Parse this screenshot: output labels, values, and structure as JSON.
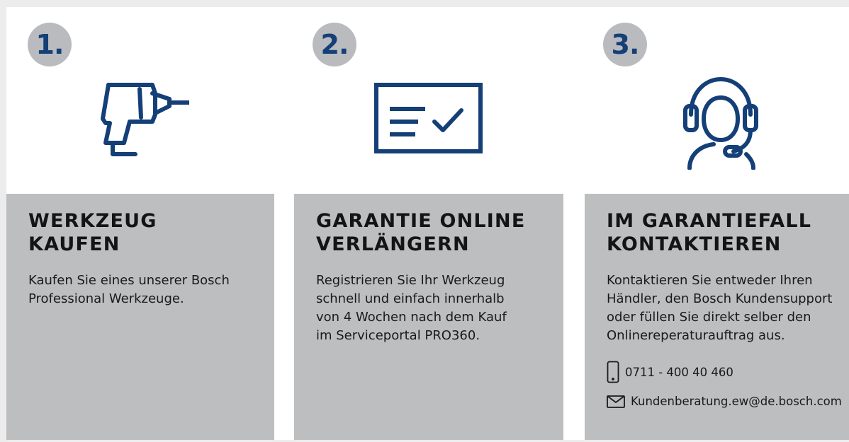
{
  "steps": [
    {
      "number": "1.",
      "icon": "drill-icon",
      "title_line1": "WERKZEUG",
      "title_line2": "KAUFEN",
      "text_line1": "Kaufen Sie eines unserer Bosch",
      "text_line2": "Professional Werkzeuge."
    },
    {
      "number": "2.",
      "icon": "certificate-check-icon",
      "title_line1": "GARANTIE ONLINE",
      "title_line2": "VERLÄNGERN",
      "text_line1": "Registrieren Sie Ihr Werkzeug",
      "text_line2": "schnell und einfach innerhalb",
      "text_line3": "von 4 Wochen nach dem Kauf",
      "text_line4": "im Serviceportal PRO360."
    },
    {
      "number": "3.",
      "icon": "headset-agent-icon",
      "title_line1": "IM GARANTIEFALL",
      "title_line2": "KONTAKTIEREN",
      "text_line1": "Kontaktieren Sie entweder Ihren",
      "text_line2": "Händler, den Bosch Kundensupport",
      "text_line3": "oder füllen Sie direkt selber den",
      "text_line4": "Onlinereperaturauftrag aus.",
      "phone": "0711 - 400 40 460",
      "email": "Kundenberatung.ew@de.bosch.com"
    }
  ],
  "colors": {
    "icon_blue": "#143f77",
    "badge_gray": "#b9bbbe",
    "panel_gray": "#bdbec0"
  }
}
